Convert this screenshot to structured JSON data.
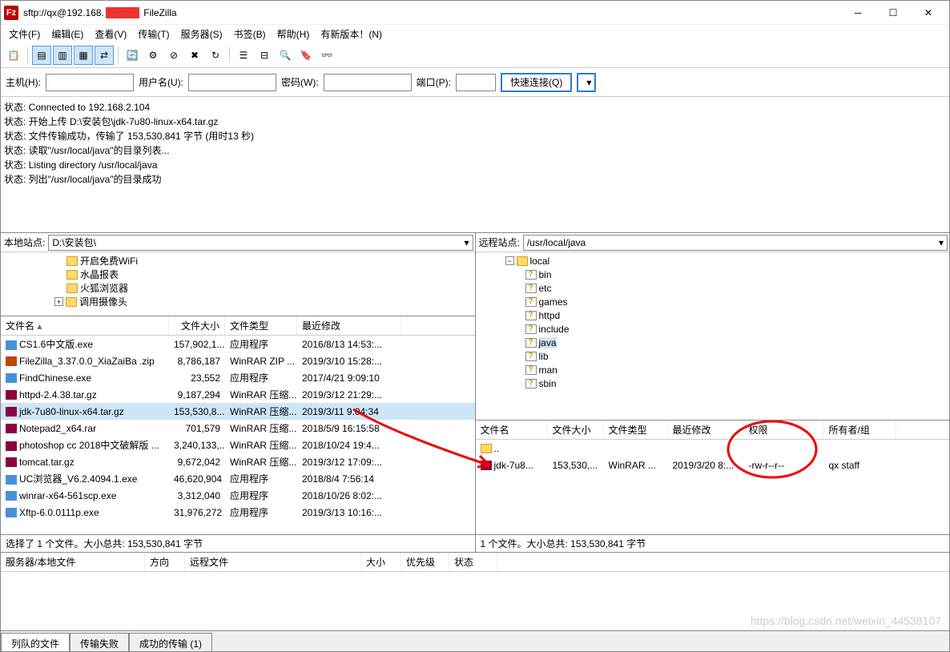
{
  "title_prefix": "sftp://qx@192.168.",
  "title_suffix": " FileZilla",
  "menu": [
    "文件(F)",
    "编辑(E)",
    "查看(V)",
    "传输(T)",
    "服务器(S)",
    "书签(B)",
    "帮助(H)",
    "有新版本！(N)"
  ],
  "qc": {
    "host_l": "主机(H):",
    "user_l": "用户名(U):",
    "pass_l": "密码(W):",
    "port_l": "端口(P):",
    "btn": "快速连接(Q)"
  },
  "log": [
    "状态: Connected to 192.168.2.104",
    "状态: 开始上传 D:\\安装包\\jdk-7u80-linux-x64.tar.gz",
    "状态: 文件传输成功，传输了 153,530,841 字节 (用时13 秒)",
    "状态: 读取\"/usr/local/java\"的目录列表...",
    "状态: Listing directory /usr/local/java",
    "状态: 列出\"/usr/local/java\"的目录成功"
  ],
  "local_label": "本地站点:",
  "local_path": "D:\\安装包\\",
  "local_tree": [
    "开启免费WiFi",
    "水晶报表",
    "火狐浏览器",
    "调用摄像头"
  ],
  "local_cols": [
    "文件名",
    "文件大小",
    "文件类型",
    "最近修改"
  ],
  "local_files": [
    {
      "n": "CS1.6中文版.exe",
      "s": "157,902,1...",
      "t": "应用程序",
      "m": "2016/8/13 14:53:...",
      "ic": "ic-exe"
    },
    {
      "n": "FileZilla_3.37.0.0_XiaZaiBa .zip",
      "s": "8,786,187",
      "t": "WinRAR ZIP ...",
      "m": "2019/3/10 15:28:...",
      "ic": "ic-zip"
    },
    {
      "n": "FindChinese.exe",
      "s": "23,552",
      "t": "应用程序",
      "m": "2017/4/21 9:09:10",
      "ic": "ic-exe"
    },
    {
      "n": "httpd-2.4.38.tar.gz",
      "s": "9,187,294",
      "t": "WinRAR 压缩...",
      "m": "2019/3/12 21:29:...",
      "ic": "ic-rar"
    },
    {
      "n": "jdk-7u80-linux-x64.tar.gz",
      "s": "153,530,8...",
      "t": "WinRAR 压缩...",
      "m": "2019/3/11 9:04:34",
      "ic": "ic-rar",
      "sel": true
    },
    {
      "n": "Notepad2_x64.rar",
      "s": "701,579",
      "t": "WinRAR 压缩...",
      "m": "2018/5/9 16:15:58",
      "ic": "ic-rar"
    },
    {
      "n": "photoshop cc 2018中文破解版 ...",
      "s": "3,240,133,...",
      "t": "WinRAR 压缩...",
      "m": "2018/10/24 19:4...",
      "ic": "ic-rar"
    },
    {
      "n": "tomcat.tar.gz",
      "s": "9,672,042",
      "t": "WinRAR 压缩...",
      "m": "2019/3/12 17:09:...",
      "ic": "ic-rar"
    },
    {
      "n": "UC浏览器_V6.2.4094.1.exe",
      "s": "46,620,904",
      "t": "应用程序",
      "m": "2018/8/4 7:56:14",
      "ic": "ic-exe"
    },
    {
      "n": "winrar-x64-561scp.exe",
      "s": "3,312,040",
      "t": "应用程序",
      "m": "2018/10/26 8:02:...",
      "ic": "ic-exe"
    },
    {
      "n": "Xftp-6.0.0111p.exe",
      "s": "31,976,272",
      "t": "应用程序",
      "m": "2019/3/13 10:16:...",
      "ic": "ic-exe"
    }
  ],
  "local_status": "选择了 1 个文件。大小总共: 153,530,841 字节",
  "remote_label": "远程站点:",
  "remote_path": "/usr/local/java",
  "remote_tree_root": "local",
  "remote_tree": [
    "bin",
    "etc",
    "games",
    "httpd",
    "include",
    "java",
    "lib",
    "man",
    "sbin"
  ],
  "remote_cols": [
    "文件名",
    "文件大小",
    "文件类型",
    "最近修改",
    "权限",
    "所有者/组"
  ],
  "remote_files": [
    {
      "n": "..",
      "ic": "ic-fold"
    },
    {
      "n": "jdk-7u8...",
      "s": "153,530,...",
      "t": "WinRAR ...",
      "m": "2019/3/20 8:...",
      "p": "-rw-r--r--",
      "o": "qx staff",
      "ic": "ic-rar"
    }
  ],
  "remote_status": "1 个文件。大小总共: 153,530,841 字节",
  "queue_cols": [
    "服务器/本地文件",
    "方向",
    "远程文件",
    "大小",
    "优先级",
    "状态"
  ],
  "tabs": [
    "列队的文件",
    "传输失败",
    "成功的传输 (1)"
  ],
  "watermark": "https://blog.csdn.net/weixin_44538107"
}
